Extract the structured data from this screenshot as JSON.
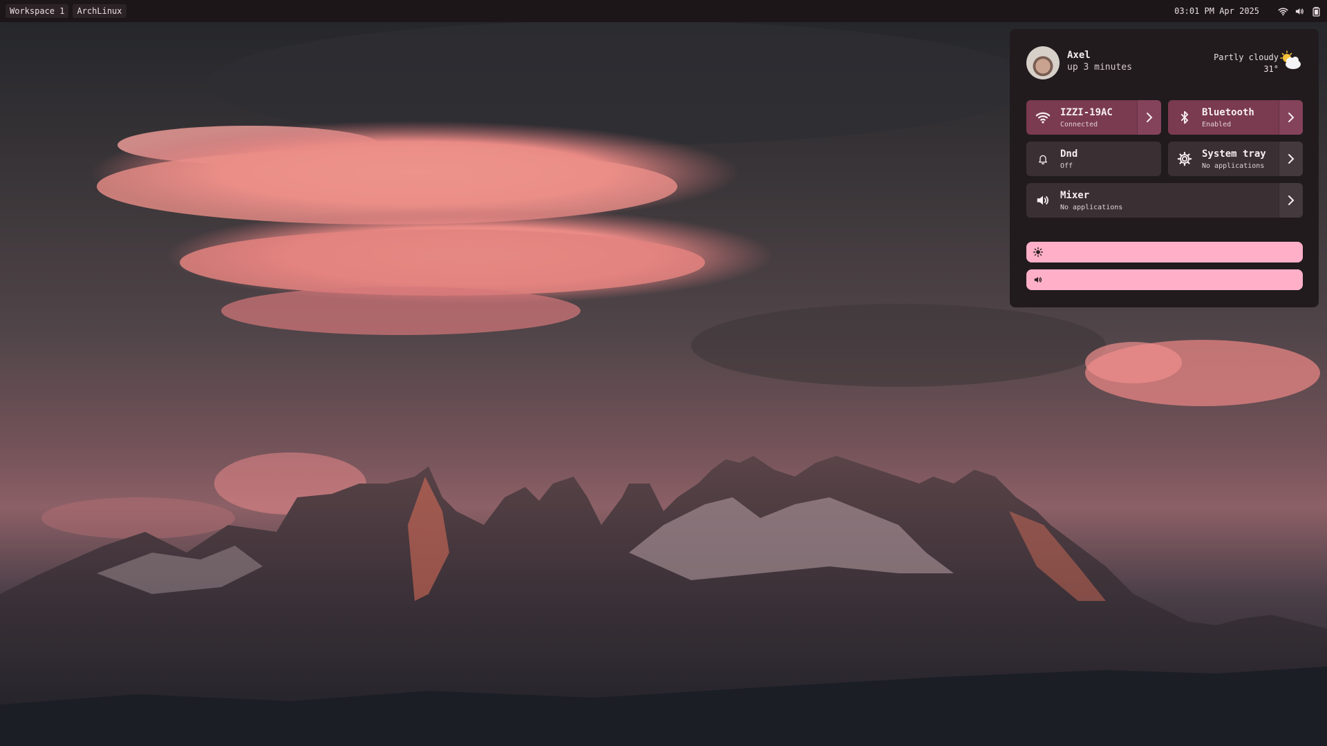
{
  "topbar": {
    "workspace_label": "Workspace 1",
    "distro_label": "ArchLinux",
    "clock": "03:01 PM Apr 2025",
    "icons": [
      "wifi-icon",
      "volume-icon",
      "battery-icon"
    ]
  },
  "panel": {
    "user": {
      "name": "Axel",
      "uptime": "up 3 minutes"
    },
    "weather": {
      "condition": "Partly cloudy",
      "temperature": "31°",
      "icon": "partly-cloudy-icon"
    },
    "tiles": {
      "wifi": {
        "title": "IZZI-19AC",
        "subtitle": "Connected",
        "icon": "wifi-icon",
        "active": true
      },
      "bluetooth": {
        "title": "Bluetooth",
        "subtitle": "Enabled",
        "icon": "bluetooth-icon",
        "active": true
      },
      "dnd": {
        "title": "Dnd",
        "subtitle": "Off",
        "icon": "bell-icon",
        "active": false
      },
      "systray": {
        "title": "System tray",
        "subtitle": "No applications",
        "icon": "gear-icon",
        "active": false
      },
      "mixer": {
        "title": "Mixer",
        "subtitle": "No applications",
        "icon": "speaker-icon",
        "active": false
      }
    },
    "sliders": {
      "brightness": {
        "icon": "sun-icon",
        "level": 1.0
      },
      "volume": {
        "icon": "speaker-icon",
        "level": 1.0
      }
    }
  },
  "colors": {
    "accent": "#7a3a4f",
    "slider": "#ffb0c8",
    "panel_bg": "#211b1e",
    "bar_bg": "#1c1619"
  }
}
